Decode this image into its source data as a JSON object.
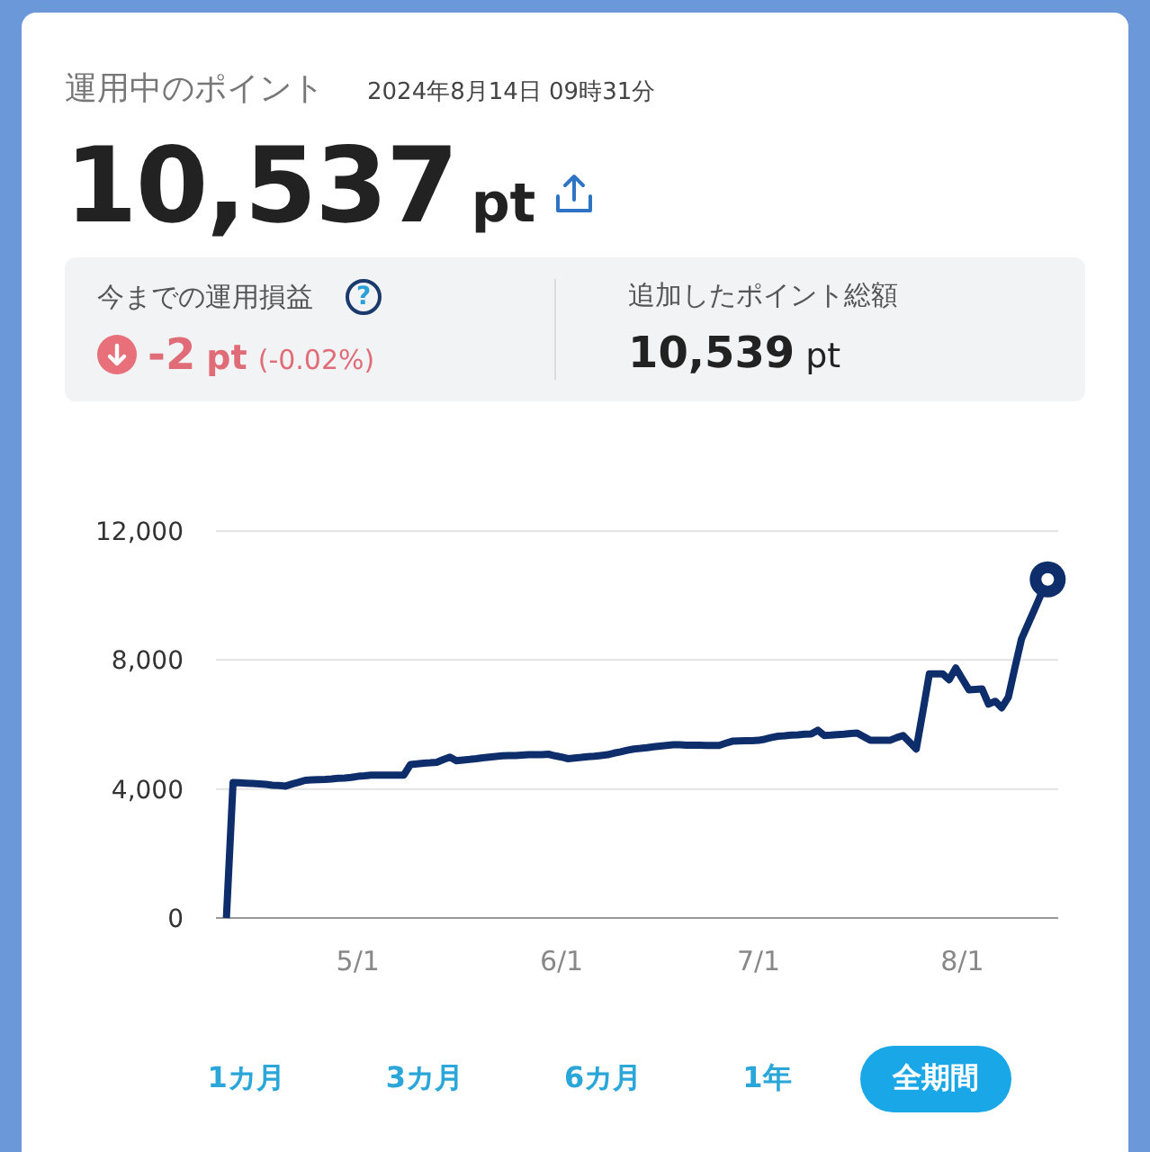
{
  "header": {
    "title": "運用中のポイント",
    "timestamp": "2024年8月14日 09時31分"
  },
  "balance": {
    "value": "10,537",
    "unit": "pt"
  },
  "summary": {
    "profit": {
      "label": "今までの運用損益",
      "help_mark": "?",
      "negative": true,
      "value": "-2",
      "unit": "pt",
      "percent": "(-0.02%)"
    },
    "added": {
      "label": "追加したポイント総額",
      "value": "10,539",
      "unit": "pt"
    }
  },
  "chart": {
    "chart_data": {
      "type": "line",
      "categories": [
        null,
        null,
        null,
        null,
        null,
        null,
        null,
        null,
        null,
        null,
        null,
        null,
        null,
        null,
        null,
        null,
        null,
        null,
        null,
        null,
        "5/1",
        null,
        null,
        null,
        null,
        null,
        null,
        null,
        null,
        null,
        null,
        null,
        null,
        null,
        null,
        null,
        null,
        null,
        null,
        null,
        null,
        null,
        null,
        null,
        null,
        null,
        null,
        null,
        null,
        null,
        null,
        "6/1",
        null,
        null,
        null,
        null,
        null,
        null,
        null,
        null,
        null,
        null,
        null,
        null,
        null,
        null,
        null,
        null,
        null,
        null,
        null,
        null,
        null,
        null,
        null,
        null,
        null,
        null,
        null,
        null,
        null,
        "7/1",
        null,
        null,
        null,
        null,
        null,
        null,
        null,
        null,
        null,
        null,
        null,
        null,
        null,
        null,
        null,
        null,
        null,
        null,
        null,
        null,
        null,
        null,
        null,
        null,
        null,
        null,
        null,
        null,
        null,
        null,
        "8/1",
        null,
        null,
        null,
        null,
        null,
        null,
        null,
        null,
        null,
        null,
        null,
        null,
        null
      ],
      "values": [
        0,
        4200,
        4190,
        4180,
        4170,
        4160,
        4140,
        4120,
        4110,
        4090,
        4150,
        4210,
        4270,
        4280,
        4290,
        4300,
        4310,
        4330,
        4340,
        4360,
        4390,
        4410,
        4430,
        4430,
        4430,
        4430,
        4430,
        4430,
        4760,
        4780,
        4800,
        4810,
        4830,
        4910,
        4990,
        4880,
        4900,
        4920,
        4940,
        4970,
        4990,
        5010,
        5030,
        5040,
        5040,
        5050,
        5060,
        5070,
        5070,
        5080,
        5030,
        4990,
        4940,
        4960,
        4980,
        5000,
        5020,
        5040,
        5060,
        5110,
        5150,
        5200,
        5240,
        5260,
        5280,
        5310,
        5330,
        5350,
        5370,
        5370,
        5360,
        5360,
        5360,
        5350,
        5350,
        5350,
        5420,
        5480,
        5490,
        5500,
        5500,
        5510,
        5550,
        5600,
        5640,
        5650,
        5670,
        5680,
        5700,
        5710,
        5820,
        5660,
        5670,
        5690,
        5700,
        5720,
        5730,
        5620,
        5510,
        5510,
        5510,
        5510,
        5590,
        5660,
        5450,
        5240,
        6400,
        7570,
        7570,
        7570,
        7390,
        7750,
        7420,
        7080,
        7090,
        7100,
        6630,
        6720,
        6520,
        6850,
        7750,
        8650,
        9110,
        9580,
        10040,
        10500
      ],
      "ylim": [
        0,
        12000
      ],
      "yticks": [
        {
          "value": 0,
          "label": "0"
        },
        {
          "value": 4000,
          "label": "4,000"
        },
        {
          "value": 8000,
          "label": "8,000"
        },
        {
          "value": 12000,
          "label": "12,000"
        }
      ]
    }
  },
  "periods": [
    {
      "label": "1カ月",
      "selected": false
    },
    {
      "label": "3カ月",
      "selected": false
    },
    {
      "label": "6カ月",
      "selected": false
    },
    {
      "label": "1年",
      "selected": false
    },
    {
      "label": "全期間",
      "selected": true
    }
  ]
}
